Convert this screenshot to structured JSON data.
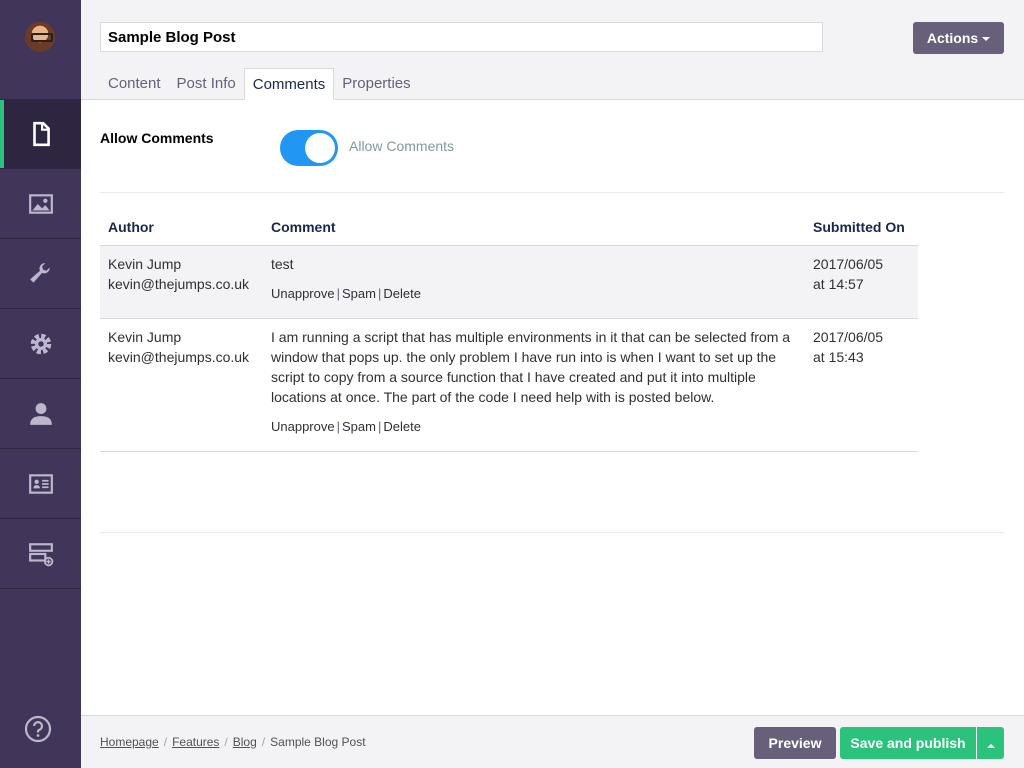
{
  "sidebar": {
    "avatar": "user-avatar",
    "items": [
      {
        "icon": "document-icon",
        "label": "Content",
        "active": true
      },
      {
        "icon": "image-icon",
        "label": "Media",
        "active": false
      },
      {
        "icon": "wrench-icon",
        "label": "Settings",
        "active": false
      },
      {
        "icon": "gear-icon",
        "label": "Developer",
        "active": false
      },
      {
        "icon": "user-icon",
        "label": "Users",
        "active": false
      },
      {
        "icon": "id-card-icon",
        "label": "Members",
        "active": false
      },
      {
        "icon": "forms-icon",
        "label": "Forms",
        "active": false
      }
    ],
    "help_icon": "question-icon"
  },
  "header": {
    "title_value": "Sample Blog Post",
    "actions_label": "Actions",
    "tabs": [
      {
        "label": "Content",
        "active": false
      },
      {
        "label": "Post Info",
        "active": false
      },
      {
        "label": "Comments",
        "active": true
      },
      {
        "label": "Properties",
        "active": false
      }
    ]
  },
  "comments_tab": {
    "allow_comments_label": "Allow Comments",
    "toggle_label": "Allow Comments",
    "toggle_on": true,
    "columns": [
      "Author",
      "Comment",
      "Submitted On"
    ],
    "rows": [
      {
        "author_name": "Kevin Jump",
        "author_email": "kevin@thejumps.co.uk",
        "comment": "test",
        "date": "2017/06/05",
        "time": "at 14:57",
        "actions": [
          "Unapprove",
          "Spam",
          "Delete"
        ]
      },
      {
        "author_name": "Kevin Jump",
        "author_email": "kevin@thejumps.co.uk",
        "comment": "I am running a script that has multiple environments in it that can be selected from a window that pops up. the only problem I have run into is when I want to set up the script to copy from a source function that I have created and put it into multiple locations at once. The part of the code I need help with is posted below.",
        "date": "2017/06/05",
        "time": "at 15:43",
        "actions": [
          "Unapprove",
          "Spam",
          "Delete"
        ]
      }
    ]
  },
  "footer": {
    "breadcrumbs": [
      "Homepage",
      "Features",
      "Blog",
      "Sample Blog Post"
    ],
    "preview_label": "Preview",
    "publish_label": "Save and publish"
  },
  "colors": {
    "sidebar": "#413659",
    "accent_green": "#2bc37c",
    "toggle_blue": "#2196f3",
    "secondary_button": "#68607a"
  }
}
